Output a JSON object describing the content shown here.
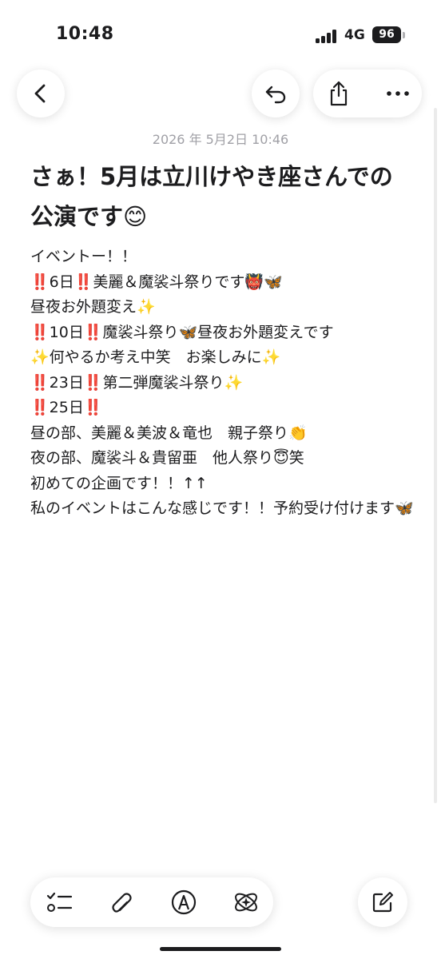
{
  "status_bar": {
    "time": "10:48",
    "network": "4G",
    "battery": "96"
  },
  "toolbar": {
    "back_icon": "chevron-left-icon",
    "undo_icon": "undo-icon",
    "share_icon": "share-icon",
    "more_icon": "ellipsis-icon"
  },
  "note": {
    "date": "2026 年 5月2日 10:46",
    "title": "さぁ！5月は立川けやき座さんでの公演です😊",
    "lines": [
      "イベントー！！",
      "‼️6日‼️美麗＆魔裟斗祭りです👹🦋",
      "昼夜お外題変え✨",
      "‼️10日‼️魔裟斗祭り🦋昼夜お外題変えです",
      "✨何やるか考え中笑　お楽しみに✨",
      "‼️23日‼️第二弾魔裟斗祭り✨",
      "‼️25日‼️",
      "昼の部、美麗＆美波＆竜也　親子祭り👏",
      "夜の部、魔裟斗＆貴留亜　他人祭り😇笑",
      "初めての企画です！！↑↑",
      "私のイベントはこんな感じです！！予約受け付けます🦋"
    ]
  },
  "bottom_toolbar": {
    "checklist_icon": "checklist-icon",
    "attachment_icon": "paperclip-icon",
    "markup_icon": "markup-pen-icon",
    "ai_icon": "writing-tools-icon",
    "compose_icon": "compose-icon"
  },
  "colors": {
    "text": "#1c1c1e",
    "muted": "#a0a0a6",
    "background": "#ffffff"
  }
}
